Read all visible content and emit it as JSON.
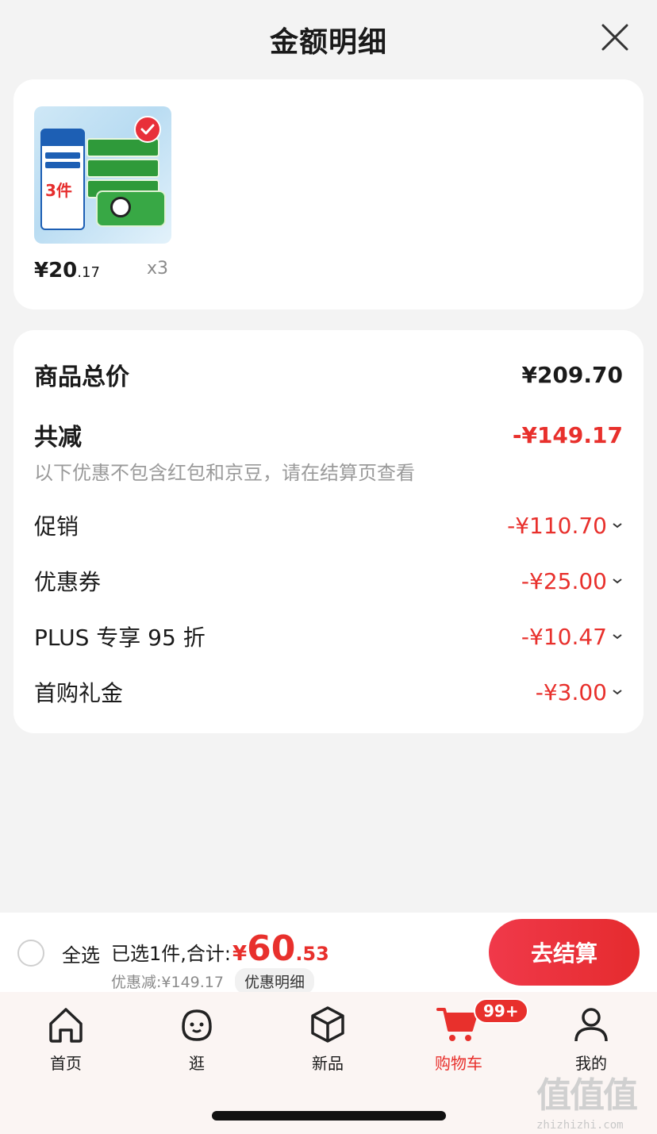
{
  "header": {
    "title": "金额明细"
  },
  "item": {
    "price_int": "¥20",
    "price_dec": ".17",
    "qty": "x3",
    "image_label": "3件"
  },
  "summary": {
    "total_label": "商品总价",
    "total_value": "¥209.70",
    "reduce_label": "共减",
    "reduce_value": "-¥149.17",
    "note": "以下优惠不包含红包和京豆，请在结算页查看",
    "lines": [
      {
        "label": "促销",
        "value": "-¥110.70"
      },
      {
        "label": "优惠券",
        "value": "-¥25.00"
      },
      {
        "label": "PLUS 专享 95 折",
        "value": "-¥10.47"
      },
      {
        "label": "首购礼金",
        "value": "-¥3.00"
      }
    ]
  },
  "checkout": {
    "select_all": "全选",
    "selected_text": "已选1件,合计:",
    "currency": "¥",
    "amount_int": "60",
    "amount_dec": ".53",
    "discount_text": "优惠减:¥149.17",
    "discount_link": "优惠明细",
    "pay_button": "去结算"
  },
  "tabbar": {
    "tabs": [
      {
        "label": "首页",
        "icon": "home-icon"
      },
      {
        "label": "逛",
        "icon": "face-icon"
      },
      {
        "label": "新品",
        "icon": "cube-icon"
      },
      {
        "label": "购物车",
        "icon": "cart-icon",
        "badge": "99+",
        "active": true
      },
      {
        "label": "我的",
        "icon": "user-icon"
      }
    ]
  },
  "watermark": {
    "glyphs": "值值值",
    "url": "zhizhizhi.com"
  },
  "colors": {
    "accent": "#e8302c",
    "background": "#f3f3f3"
  }
}
